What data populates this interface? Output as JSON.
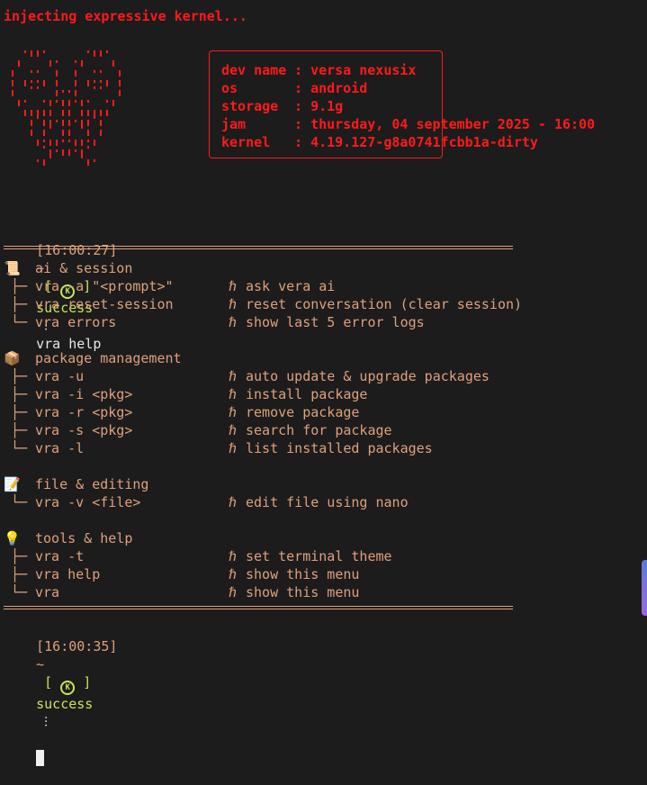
{
  "banner": "injecting expressive kernel...",
  "sysinfo": [
    {
      "key": "dev name",
      "value": "versa nexusix"
    },
    {
      "key": "os",
      "value": "android"
    },
    {
      "key": "storage",
      "value": "9.1g"
    },
    {
      "key": "jam",
      "value": "thursday, 04 september 2025 - 16:00"
    },
    {
      "key": "kernel",
      "value": "4.19.127-g8a0741fcbb1a-dirty"
    }
  ],
  "prompt1": {
    "time": "[16:00:27]",
    "tilde": "~",
    "status": "success",
    "command": "vra help"
  },
  "prompt2": {
    "time": "[16:00:35]",
    "tilde": "~",
    "status": "success",
    "command": ""
  },
  "sections": [
    {
      "icon": "scroll-icon",
      "title": "ai & session",
      "items": [
        {
          "tree": "├─",
          "cmd": "vra -a \"<prompt>\"",
          "desc": "ask vera ai"
        },
        {
          "tree": "├─",
          "cmd": "vra reset-session",
          "desc": "reset conversation (clear session)"
        },
        {
          "tree": "└─",
          "cmd": "vra errors",
          "desc": "show last 5 error logs"
        }
      ]
    },
    {
      "icon": "package-icon",
      "title": "package management",
      "items": [
        {
          "tree": "├─",
          "cmd": "vra -u",
          "desc": "auto update & upgrade packages"
        },
        {
          "tree": "├─",
          "cmd": "vra -i <pkg>",
          "desc": "install package"
        },
        {
          "tree": "├─",
          "cmd": "vra -r <pkg>",
          "desc": "remove package"
        },
        {
          "tree": "├─",
          "cmd": "vra -s <pkg>",
          "desc": "search for package"
        },
        {
          "tree": "└─",
          "cmd": "vra -l",
          "desc": "list installed packages"
        }
      ]
    },
    {
      "icon": "memo-icon",
      "title": "file & editing",
      "items": [
        {
          "tree": "└─",
          "cmd": "vra -v <file>",
          "desc": "edit file using nano"
        }
      ]
    },
    {
      "icon": "lightbulb-icon",
      "title": "tools & help",
      "items": [
        {
          "tree": "├─",
          "cmd": "vra -t",
          "desc": "set terminal theme"
        },
        {
          "tree": "├─",
          "cmd": "vra help",
          "desc": "show this menu"
        },
        {
          "tree": "└─",
          "cmd": "vra",
          "desc": "show this menu"
        }
      ]
    }
  ],
  "arrow_glyph": "ℏ",
  "colors": {
    "red": "#ff1a1a",
    "tan": "#e0a07a",
    "green": "#c8e65a",
    "background": "#1c1c1c"
  }
}
